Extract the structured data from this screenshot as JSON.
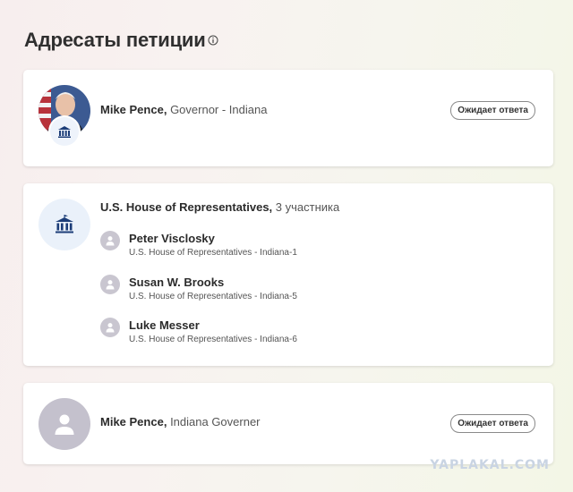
{
  "page": {
    "title": "Адресаты петиции",
    "info_icon": "info-icon"
  },
  "cards": [
    {
      "name": "Mike Pence,",
      "role": "Governor - Indiana",
      "status": "Ожидает ответа",
      "icon": "photo + government-building-icon"
    },
    {
      "name": "U.S. House of Representatives,",
      "count": "3 участника",
      "icon": "government-building-icon",
      "members": [
        {
          "name": "Peter Visclosky",
          "role": "U.S. House of Representatives - Indiana-1"
        },
        {
          "name": "Susan W. Brooks",
          "role": "U.S. House of Representatives - Indiana-5"
        },
        {
          "name": "Luke Messer",
          "role": "U.S. House of Representatives - Indiana-6"
        }
      ]
    },
    {
      "name": "Mike Pence,",
      "role": "Indiana Governer",
      "status": "Ожидает ответа",
      "icon": "user-avatar-icon"
    }
  ],
  "watermark": "YAPLAKAL.COM",
  "colors": {
    "badge_border": "#8a8a8a",
    "avatar_gray": "#c4c1cd",
    "building_blue": "#1c3d78",
    "building_bg": "#eaf1fa"
  }
}
